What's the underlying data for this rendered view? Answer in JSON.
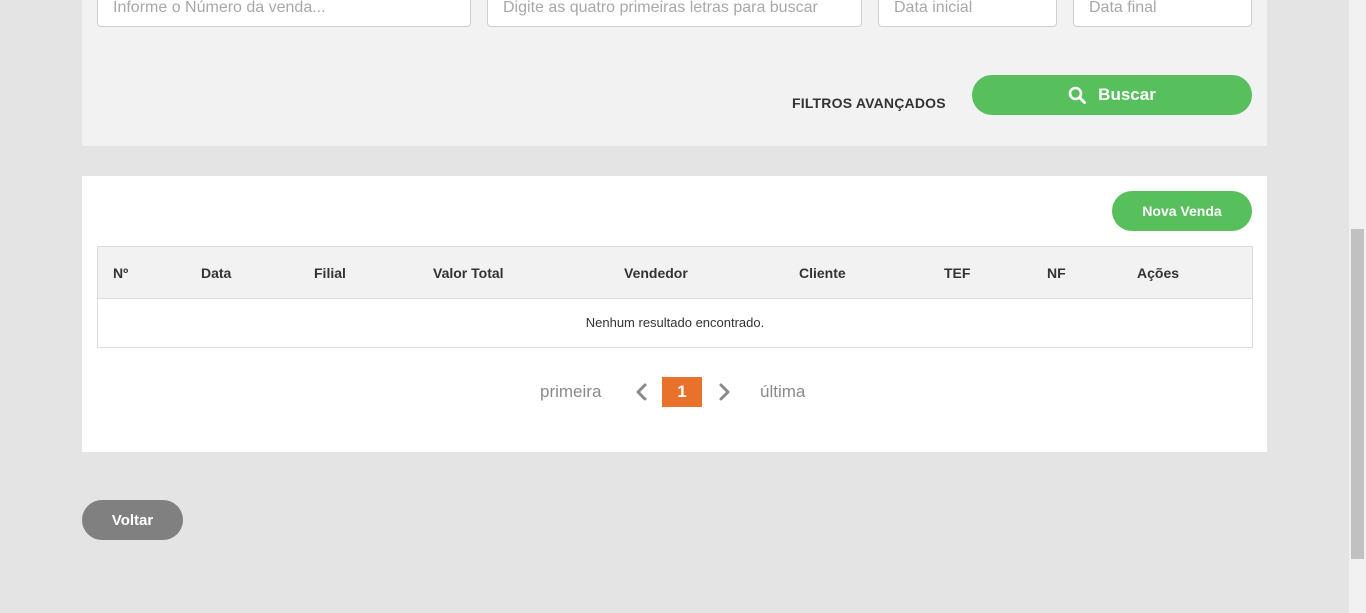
{
  "filters": {
    "numero_venda_placeholder": "Informe o Número da venda...",
    "cliente_placeholder": "Digite as quatro primeiras letras para buscar",
    "data_inicial_placeholder": "Data inicial",
    "data_final_placeholder": "Data final",
    "advanced_label": "FILTROS AVANÇADOS",
    "search_label": "Buscar",
    "search_icon": "search-icon"
  },
  "results": {
    "new_sale_label": "Nova Venda",
    "columns": [
      "Nº",
      "Data",
      "Filial",
      "Valor Total",
      "Vendedor",
      "Cliente",
      "TEF",
      "NF",
      "Ações"
    ],
    "empty_message": "Nenhum resultado encontrado."
  },
  "pagination": {
    "first_label": "primeira",
    "current_page": "1",
    "last_label": "última"
  },
  "footer": {
    "back_label": "Voltar"
  },
  "colors": {
    "primary_green": "#57bf5c",
    "pagination_active": "#e8712c",
    "back_button": "#808080",
    "page_background": "#e4e4e4"
  }
}
